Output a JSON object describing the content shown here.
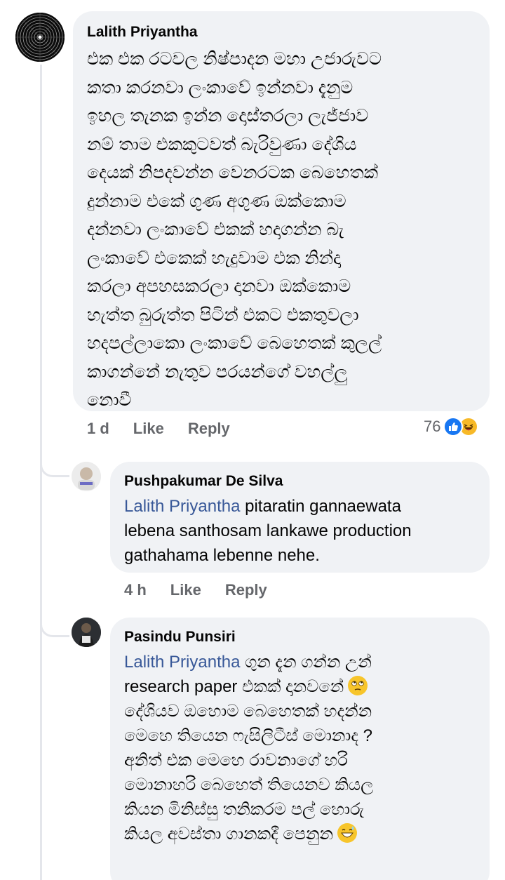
{
  "comments": [
    {
      "author": "Lalith Priyantha",
      "text": "එක එක රටවල නිෂ්පාදන මහා උජාරුවට\nකතා කරනවා ලංකාවේ ඉන්නවා දැනුම\nඉහල තැනක ඉන්න දොස්තරලා ලැජ්ජාව\nනම් තාම එකකුටවත් බැරිවුණා දේශිය\nදෙයක් නිපදවන්න වෙනරටක බෙහෙතක්\nදුන්නාම එකේ ගුණ අගුණ ඔක්කොම\nදන්නවා ලංකාවේ එකක් හදාගන්න බැ\nලංකාවේ එකෙක් හැදුවාම එක නින්දා\nකරලා අපහසකරලා දානවා ඔක්කොම\nහැත්ත බුරුත්ත පිටින් එකට එකතුවලා\nහදපල්ලාකො ලංකාවේ බෙහෙතක් කුලල්\nකාගන්නේ නැතුව පරයන්ගේ වහල්ලු\nනොවී",
      "time": "1 d",
      "like": "Like",
      "reply": "Reply",
      "reaction_count": "76",
      "reactions": [
        "like-icon",
        "haha-icon"
      ]
    }
  ],
  "replies": [
    {
      "author": "Pushpakumar De Silva",
      "mention": "Lalith Priyantha",
      "text": " pitaratin gannaewata\nlebena santhosam lankawe production\ngathahama lebenne nehe.",
      "time": "4 h",
      "like": "Like",
      "reply": "Reply"
    },
    {
      "author": "Pasindu Punsiri",
      "mention": "Lalith Priyantha",
      "text_1": "  ගුන දැන ගන්න උන්\nresearch paper එකක් දානවනේ",
      "text_2": "\nදේශියව ඔහොම බෙහෙතක් හදන්න\nමෙහෙ තියෙන ෆැසිලිටීස් මොනාද ?\nඅනිත් එක මෙහෙ රාවනාගේ හරි\nමොනාහරි බෙහෙත් තියෙනව කියල\nකියන මිනිස්සු තනිකරම පල් හොරු\nකියල අවස්තා ගානකදී පෙනුන",
      "emoji_1": "face-with-rolling-eyes",
      "emoji_2": "grinning-face-with-sweat"
    }
  ],
  "colors": {
    "bubble": "#f0f2f5",
    "mention": "#385898",
    "meta": "#65676b",
    "like_blue": "#1877f2",
    "haha_yellow": "#f7b928"
  }
}
